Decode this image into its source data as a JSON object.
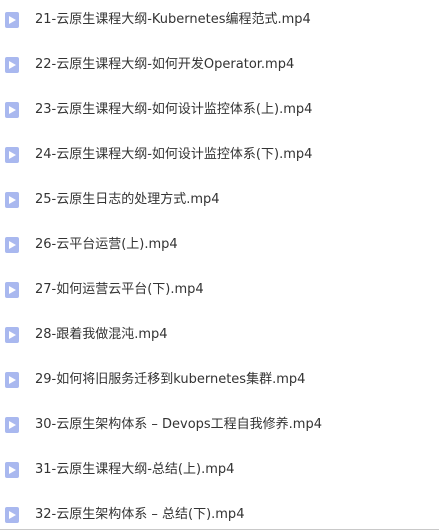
{
  "icon_color": "#a9b8ef",
  "icon_name": "video-file-icon",
  "files": [
    {
      "name": "21-云原生课程大纲-Kubernetes编程范式.mp4"
    },
    {
      "name": "22-云原生课程大纲-如何开发Operator.mp4"
    },
    {
      "name": "23-云原生课程大纲-如何设计监控体系(上).mp4"
    },
    {
      "name": "24-云原生课程大纲-如何设计监控体系(下).mp4"
    },
    {
      "name": "25-云原生日志的处理方式.mp4"
    },
    {
      "name": "26-云平台运营(上).mp4"
    },
    {
      "name": "27-如何运营云平台(下).mp4"
    },
    {
      "name": "28-跟着我做混沌.mp4"
    },
    {
      "name": "29-如何将旧服务迁移到kubernetes集群.mp4"
    },
    {
      "name": "30-云原生架构体系 – Devops工程自我修养.mp4"
    },
    {
      "name": "31-云原生课程大纲-总结(上).mp4"
    },
    {
      "name": "32-云原生架构体系 – 总结(下).mp4"
    }
  ]
}
